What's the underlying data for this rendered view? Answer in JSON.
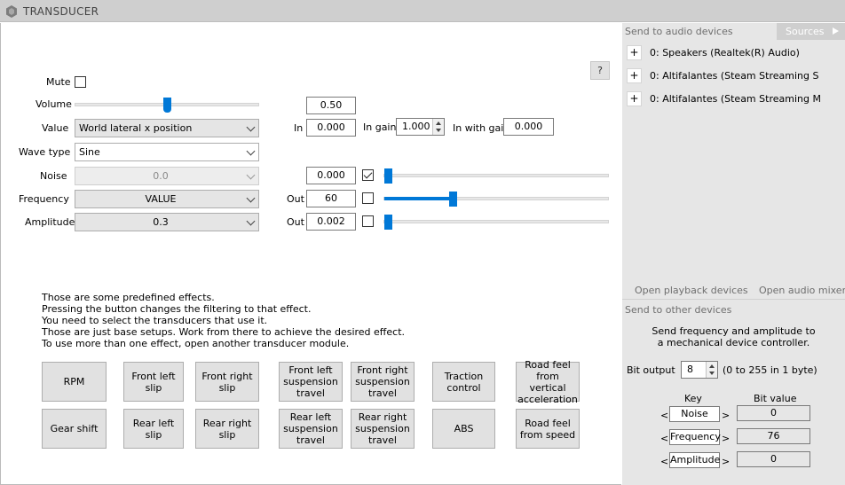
{
  "window": {
    "title": "TRANSDUCER"
  },
  "help": {
    "label": "?"
  },
  "controls": {
    "mute_label": "Mute",
    "volume_label": "Volume",
    "volume_value": "0.50",
    "volume_level": 0.5,
    "value_label": "Value",
    "value_selected": "World lateral x position",
    "in_label": "In",
    "in_value": "0.000",
    "in_gain_label": "In gain",
    "in_gain_value": "1.000",
    "in_with_gain_label": "In with gain",
    "in_with_gain_value": "0.000",
    "wave_type_label": "Wave type",
    "wave_type_selected": "Sine",
    "noise_label": "Noise",
    "noise_selected": "0.0",
    "noise_value": "0.000",
    "noise_checked": true,
    "noise_slider_level": 0.0,
    "frequency_label": "Frequency",
    "frequency_selected": "VALUE",
    "frequency_out_label": "Out",
    "frequency_out_value": "60",
    "frequency_checked": false,
    "frequency_slider_level": 0.3,
    "amplitude_label": "Amplitude",
    "amplitude_selected": "0.3",
    "amplitude_out_label": "Out",
    "amplitude_out_value": "0.002",
    "amplitude_checked": false,
    "amplitude_slider_level": 0.0
  },
  "info_lines": [
    "Those are some predefined effects.",
    "Pressing the button changes the filtering to that effect.",
    "You need to select the transducers that use it.",
    "Those are just base setups. Work from there to achieve the desired effect.",
    "To use more than one effect, open another transducer module."
  ],
  "effects": {
    "rpm": "RPM",
    "gear_shift": "Gear shift",
    "front_left_slip": "Front left slip",
    "rear_left_slip": "Rear left slip",
    "front_right_slip": "Front right slip",
    "rear_right_slip": "Rear right slip",
    "front_left_susp": "Front left suspension travel",
    "rear_left_susp": "Rear left suspension travel",
    "front_right_susp": "Front right suspension travel",
    "rear_right_susp": "Rear right suspension travel",
    "traction_control": "Traction control",
    "abs": "ABS",
    "road_feel_vertical": "Road feel from vertical acceleration",
    "road_feel_speed": "Road feel from speed"
  },
  "audio": {
    "header": "Send to audio devices",
    "sources_tab": "Sources",
    "plus": "+",
    "devices": [
      "0: Speakers (Realtek(R) Audio)",
      "0: Altifalantes (Steam Streaming S",
      "0: Altifalantes (Steam Streaming M"
    ],
    "open_playback": "Open playback devices",
    "open_mixer": "Open audio mixer"
  },
  "other": {
    "header": "Send to other devices",
    "desc_line1": "Send frequency and amplitude to",
    "desc_line2": "a mechanical device controller.",
    "bit_output_label": "Bit output",
    "bit_output_value": "8",
    "bit_output_hint": "(0 to 255 in 1 byte)",
    "key_header": "Key",
    "bit_value_header": "Bit value",
    "lt": "<",
    "gt": ">",
    "rows": [
      {
        "key": "Noise",
        "value": "0"
      },
      {
        "key": "Frequency",
        "value": "76"
      },
      {
        "key": "Amplitude",
        "value": "0"
      }
    ]
  }
}
